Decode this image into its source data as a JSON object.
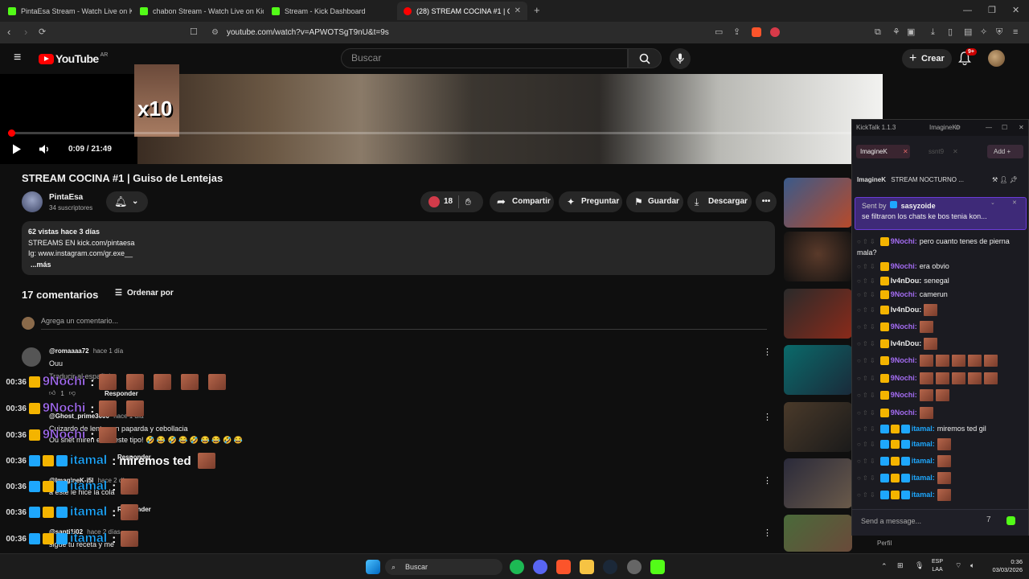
{
  "browser": {
    "tabs": [
      {
        "label": "PintaEsa Stream - Watch Live on Kick",
        "active": false,
        "favicon_color": "#53fc18"
      },
      {
        "label": "chabon Stream - Watch Live on Kick",
        "active": false,
        "favicon_color": "#53fc18"
      },
      {
        "label": "Stream - Kick Dashboard",
        "active": false,
        "favicon_color": "#53fc18"
      },
      {
        "label": "(28) STREAM COCINA #1 | Guiso",
        "active": true,
        "favicon_color": "#ff0000"
      }
    ],
    "url": "youtube.com/watch?v=APWOTSgT9nU&t=9s"
  },
  "youtube": {
    "logo_text": "YouTube",
    "region": "AR",
    "search_placeholder": "Buscar",
    "create_label": "Crear",
    "notifications_badge": "9+",
    "player": {
      "time": "0:09 / 21:49",
      "progress": 0.007,
      "overlay_text": "x10"
    },
    "video": {
      "title": "STREAM COCINA #1 | Guiso de Lentejas",
      "channel": "PintaEsa",
      "subscribers": "34 suscriptores",
      "likes": "18",
      "share_label": "Compartir",
      "ask_label": "Preguntar",
      "save_label": "Guardar",
      "download_label": "Descargar"
    },
    "description": {
      "stats": "62 vistas  hace 3 días",
      "line1": "STREAMS EN kick.com/pintaesa",
      "line2": "Ig: www.instagram.com/gr.exe__",
      "more": "...más"
    },
    "comments": {
      "count_label": "17 comentarios",
      "sort_label": "Ordenar por",
      "add_placeholder": "Agrega un comentario...",
      "items": [
        {
          "author": "@romaaaa72",
          "time": "hace 1 día",
          "text": "Ouu",
          "translate": "Traducir al español",
          "likes": "1",
          "reply": "Responder"
        },
        {
          "author": "@Ghost_prime3000",
          "time": "hace 1 día",
          "text": "Cuizardo de lente con paparda y cebollacia",
          "text2": "Ou snet miren el  de este tipo! 🤣 😂 🤣 😂 🤣 😂 😂 🤣 😂",
          "reply": "Responder"
        },
        {
          "author": "@ImagineK-j5l",
          "time": "hace 2 días",
          "text": "a este le hice la cola",
          "reply": "Responder"
        },
        {
          "author": "@santi1i02",
          "time": "hace 2 días",
          "text": "sigue tu receta y me",
          "reply": "Responder"
        }
      ]
    },
    "sidebar_footer": {
      "label": "Perfil"
    }
  },
  "overlay_chat": [
    {
      "time": "00:36",
      "user": "9Nochi",
      "color": "#a46cf2",
      "text": "",
      "emotes": 5
    },
    {
      "time": "00:36",
      "user": "9Nochi",
      "color": "#a46cf2",
      "text": "",
      "emotes": 2
    },
    {
      "time": "00:36",
      "user": "9Nochi",
      "color": "#a46cf2",
      "text": "",
      "emotes": 1
    },
    {
      "time": "00:36",
      "user": "itamal",
      "color": "#1ea7fd",
      "text": "miremos ted",
      "emotes": 1
    },
    {
      "time": "00:36",
      "user": "itamal",
      "color": "#1ea7fd",
      "text": "",
      "emotes": 1
    },
    {
      "time": "00:36",
      "user": "itamal",
      "color": "#1ea7fd",
      "text": "",
      "emotes": 1
    },
    {
      "time": "00:36",
      "user": "itamal",
      "color": "#1ea7fd",
      "text": "",
      "emotes": 1
    },
    {
      "time": "00:36",
      "user": "itamal",
      "color": "#1ea7fd",
      "text": "",
      "emotes": 1
    }
  ],
  "kicktalk": {
    "title": "KickTalk 1.1.3",
    "user": "ImagineK",
    "tab_active": "ImagineK",
    "tab_other": "ssnt9",
    "add_label": "Add",
    "channel_line": "STREAM NOCTURNO ...",
    "channel_user": "ImagineK",
    "pinned_sender_prefix": "Sent by",
    "pinned_sender": "sasyzoide",
    "pinned_text": "se filtraron los chats ke bos tenia kon...",
    "messages": [
      {
        "user": "9Nochi",
        "color": "#a46cf2",
        "text": "pero cuanto tenes de pierna",
        "emotes": 0
      },
      {
        "user": "",
        "color": "#eeeeee",
        "text": "mala?",
        "emotes": 0
      },
      {
        "user": "9Nochi",
        "color": "#a46cf2",
        "text": "era obvio",
        "emotes": 0
      },
      {
        "user": "Iv4nDou",
        "color": "#e8e8e8",
        "text": "senegal",
        "emotes": 0
      },
      {
        "user": "9Nochi",
        "color": "#a46cf2",
        "text": "camerun",
        "emotes": 0
      },
      {
        "user": "Iv4nDou",
        "color": "#e8e8e8",
        "text": "",
        "emotes": 1
      },
      {
        "user": "9Nochi",
        "color": "#a46cf2",
        "text": "",
        "emotes": 1
      },
      {
        "user": "Iv4nDou",
        "color": "#e8e8e8",
        "text": "",
        "emotes": 1
      },
      {
        "user": "9Nochi",
        "color": "#a46cf2",
        "text": "",
        "emotes": 5
      },
      {
        "user": "9Nochi",
        "color": "#a46cf2",
        "text": "",
        "emotes": 5
      },
      {
        "user": "9Nochi",
        "color": "#a46cf2",
        "text": "",
        "emotes": 2
      },
      {
        "user": "9Nochi",
        "color": "#a46cf2",
        "text": "",
        "emotes": 1
      },
      {
        "user": "itamal",
        "color": "#1ea7fd",
        "text": "miremos ted gil",
        "emotes": 0
      },
      {
        "user": "itamal",
        "color": "#1ea7fd",
        "text": "",
        "emotes": 1
      },
      {
        "user": "itamal",
        "color": "#1ea7fd",
        "text": "",
        "emotes": 1
      },
      {
        "user": "itamal",
        "color": "#1ea7fd",
        "text": "",
        "emotes": 1
      },
      {
        "user": "itamal",
        "color": "#1ea7fd",
        "text": "",
        "emotes": 1
      }
    ],
    "input_placeholder": "Send a message..."
  },
  "taskbar": {
    "search_label": "Buscar",
    "lang_top": "ESP",
    "lang_bottom": "LAA",
    "clock_time": "0:36",
    "clock_date": "03/03/2026"
  },
  "colors": {
    "accent_red": "#ff0000",
    "kick_green": "#53fc18",
    "kicktalk_purple": "#6a3bd6"
  }
}
